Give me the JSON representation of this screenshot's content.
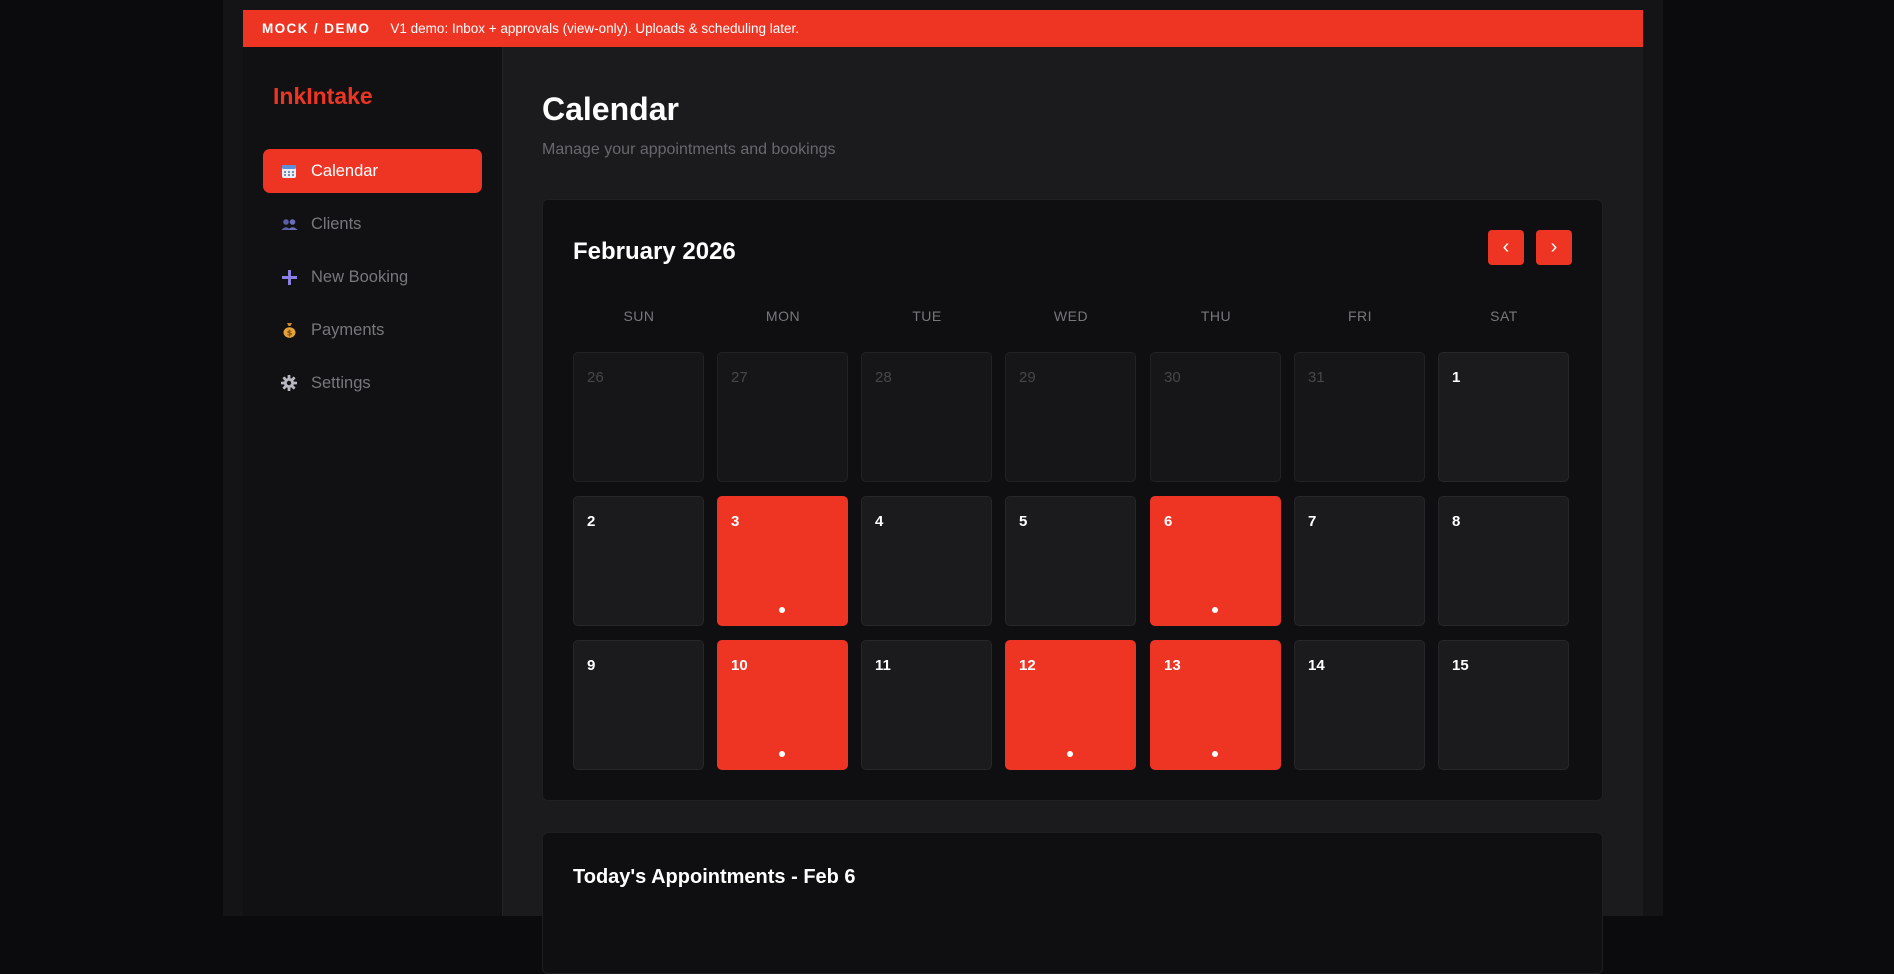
{
  "banner": {
    "tag": "MOCK / DEMO",
    "message": "V1 demo: Inbox + approvals (view-only). Uploads & scheduling later."
  },
  "brand": "InkIntake",
  "nav": [
    {
      "label": "Calendar",
      "icon": "calendar-icon",
      "active": true
    },
    {
      "label": "Clients",
      "icon": "users-icon",
      "active": false
    },
    {
      "label": "New Booking",
      "icon": "plus-icon",
      "active": false
    },
    {
      "label": "Payments",
      "icon": "money-bag-icon",
      "active": false
    },
    {
      "label": "Settings",
      "icon": "gear-icon",
      "active": false
    }
  ],
  "page": {
    "title": "Calendar",
    "subtitle": "Manage your appointments and bookings"
  },
  "calendar": {
    "month_label": "February 2026",
    "prev_label": "‹",
    "next_label": "›",
    "weekdays": [
      "SUN",
      "MON",
      "TUE",
      "WED",
      "THU",
      "FRI",
      "SAT"
    ],
    "weeks": [
      [
        {
          "day": "26",
          "muted": true,
          "booked": false
        },
        {
          "day": "27",
          "muted": true,
          "booked": false
        },
        {
          "day": "28",
          "muted": true,
          "booked": false
        },
        {
          "day": "29",
          "muted": true,
          "booked": false
        },
        {
          "day": "30",
          "muted": true,
          "booked": false
        },
        {
          "day": "31",
          "muted": true,
          "booked": false
        },
        {
          "day": "1",
          "muted": false,
          "booked": false
        }
      ],
      [
        {
          "day": "2",
          "muted": false,
          "booked": false
        },
        {
          "day": "3",
          "muted": false,
          "booked": true
        },
        {
          "day": "4",
          "muted": false,
          "booked": false
        },
        {
          "day": "5",
          "muted": false,
          "booked": false
        },
        {
          "day": "6",
          "muted": false,
          "booked": true
        },
        {
          "day": "7",
          "muted": false,
          "booked": false
        },
        {
          "day": "8",
          "muted": false,
          "booked": false
        }
      ],
      [
        {
          "day": "9",
          "muted": false,
          "booked": false
        },
        {
          "day": "10",
          "muted": false,
          "booked": true
        },
        {
          "day": "11",
          "muted": false,
          "booked": false
        },
        {
          "day": "12",
          "muted": false,
          "booked": true
        },
        {
          "day": "13",
          "muted": false,
          "booked": true
        },
        {
          "day": "14",
          "muted": false,
          "booked": false
        },
        {
          "day": "15",
          "muted": false,
          "booked": false
        }
      ]
    ]
  },
  "appointments": {
    "title": "Today's Appointments - Feb 6"
  },
  "colors": {
    "accent": "#ee3524",
    "background": "#0b0b0d",
    "panel": "#1b1b1e",
    "card": "#0f0f11"
  }
}
